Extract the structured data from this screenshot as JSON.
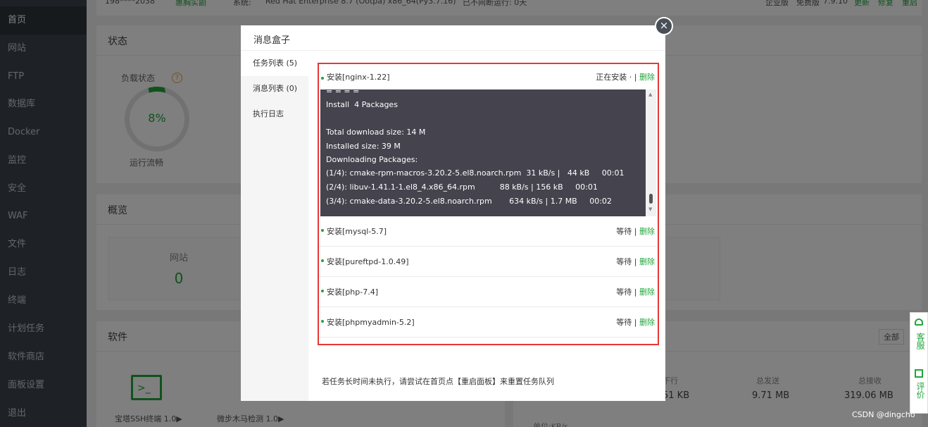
{
  "sidebar": {
    "items": [
      {
        "label": "首页"
      },
      {
        "label": "网站"
      },
      {
        "label": "FTP"
      },
      {
        "label": "数据库"
      },
      {
        "label": "Docker"
      },
      {
        "label": "监控"
      },
      {
        "label": "安全"
      },
      {
        "label": "WAF"
      },
      {
        "label": "文件"
      },
      {
        "label": "日志"
      },
      {
        "label": "终端"
      },
      {
        "label": "计划任务"
      },
      {
        "label": "软件商店"
      },
      {
        "label": "面板设置"
      },
      {
        "label": "退出"
      }
    ]
  },
  "topbar": {
    "user": "198****2038",
    "cert": "惠胸实副",
    "system_label": "系统:",
    "system": "Red Hat Enterprise 8.7 (Ootpa) x86_64(Py3.7.16)",
    "uptime": "已不间断运行: 0天",
    "edition": "企业版",
    "version_label": "免费版",
    "version": "7.9.10",
    "update": "更新",
    "repair": "修复",
    "restart": "重启"
  },
  "status_panel": {
    "title": "状态",
    "load_label": "负载状态",
    "help": "?",
    "load_value": "8%",
    "load_state": "运行流畅"
  },
  "overview_panel": {
    "title": "概览",
    "site_label": "网站",
    "site_value": "0"
  },
  "software_panel": {
    "title": "软件",
    "items": [
      {
        "label": "宝塔SSH终端 1.0▶"
      },
      {
        "label": "微步木马检测 1.0▶"
      }
    ]
  },
  "traffic_panel": {
    "all_button": "全部",
    "cols": [
      {
        "label": "下行",
        "value": "51 KB"
      },
      {
        "label": "总发送",
        "value": "9.71 MB"
      },
      {
        "label": "总接收",
        "value": "319.06 MB"
      }
    ],
    "unit": "单位:KB/s"
  },
  "modal": {
    "title": "消息盒子",
    "close": "×",
    "nav": [
      {
        "label": "任务列表 (5)"
      },
      {
        "label": "消息列表 (0)"
      },
      {
        "label": "执行日志"
      }
    ],
    "tasks": [
      {
        "name": "安装[nginx-1.22]",
        "status": "正在安装 · ",
        "sep": "|",
        "delete": "删除"
      },
      {
        "name": "安装[mysql-5.7]",
        "status": "等待",
        "sep": "|",
        "delete": "删除"
      },
      {
        "name": "安装[pureftpd-1.0.49]",
        "status": "等待",
        "sep": "|",
        "delete": "删除"
      },
      {
        "name": "安装[php-7.4]",
        "status": "等待",
        "sep": "|",
        "delete": "删除"
      },
      {
        "name": "安装[phpmyadmin-5.2]",
        "status": "等待",
        "sep": "|",
        "delete": "删除"
      }
    ],
    "console_lines": [
      "= = = =",
      "Install  4 Packages",
      "",
      "Total download size: 14 M",
      "Installed size: 39 M",
      "Downloading Packages:",
      "(1/4): cmake-rpm-macros-3.20.2-5.el8.noarch.rpm  31 kB/s |   44 kB     00:01",
      "(2/4): libuv-1.41.1-1.el8_4.x86_64.rpm          88 kB/s | 156 kB     00:01",
      "(3/4): cmake-data-3.20.2-5.el8.noarch.rpm       634 kB/s | 1.7 MB     00:02"
    ],
    "footer_note": "若任务长时间未执行，请尝试在首页点【重启面板】来重置任务队列"
  },
  "float_bar": {
    "service": "客服",
    "review": "评价"
  },
  "watermark": "CSDN @dingcho",
  "colors": {
    "accent": "#20a53a",
    "highlight_border": "#e53935",
    "sidebar_bg": "#3c444d",
    "console_bg": "#44434e"
  }
}
